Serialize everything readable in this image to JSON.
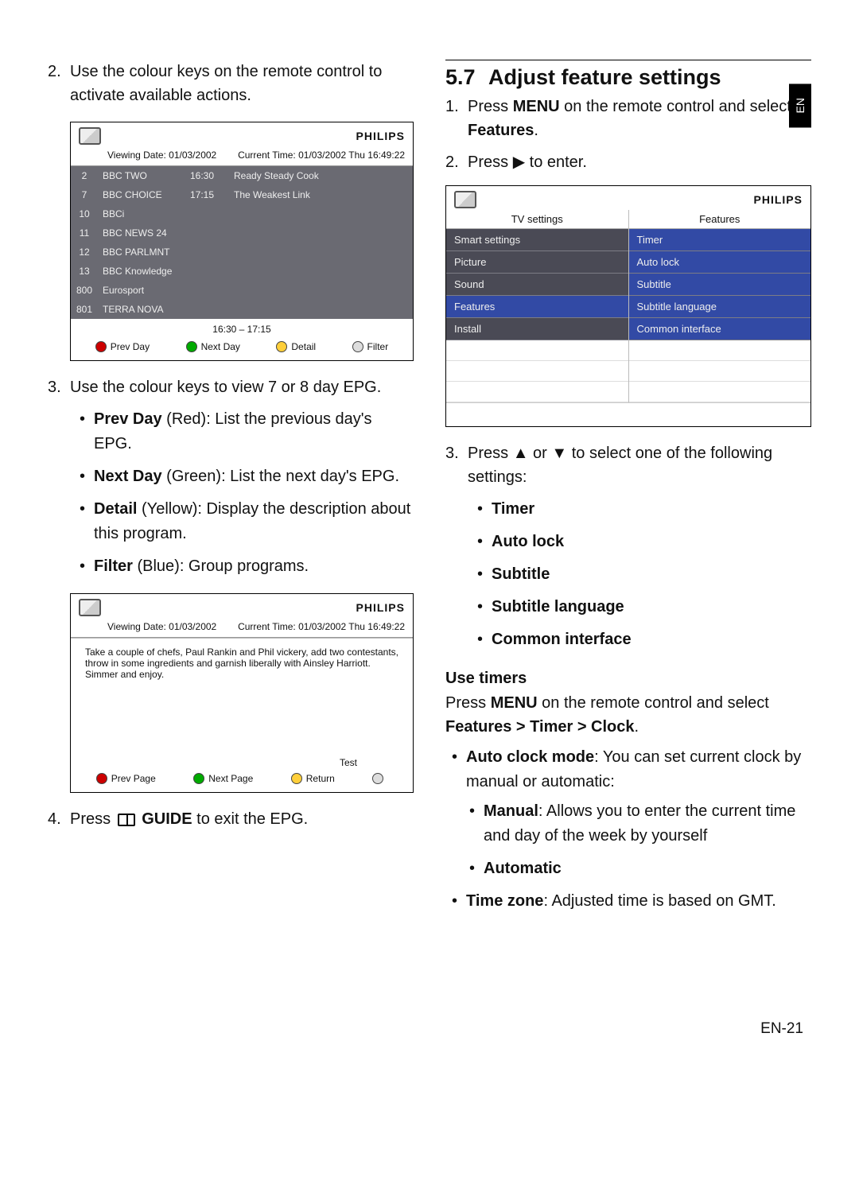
{
  "side_tab": "EN",
  "footer": "EN-21",
  "left": {
    "step2_num": "2.",
    "step2": "Use the colour keys on the remote control to activate available actions.",
    "step3_num": "3.",
    "step3": "Use the colour keys to view 7 or 8 day EPG.",
    "b_prev_label": "Prev Day",
    "b_prev_desc": " (Red): List the previous day's EPG.",
    "b_next_label": "Next Day",
    "b_next_desc": " (Green): List the next day's EPG.",
    "b_detail_label": "Detail",
    "b_detail_desc": " (Yellow): Display the description about this program.",
    "b_filter_label": "Filter",
    "b_filter_desc": " (Blue): Group programs.",
    "step4_num": "4.",
    "step4_a": "Press ",
    "step4_b": " GUIDE",
    "step4_c": " to exit the EPG."
  },
  "epg1": {
    "brand": "PHILIPS",
    "viewing_l": "Viewing Date: 01/03/2002",
    "viewing_r": "Current Time: 01/03/2002 Thu 16:49:22",
    "rows": [
      {
        "n": "2",
        "name": "BBC TWO",
        "t": "16:30",
        "p": "Ready Steady Cook",
        "sel": false
      },
      {
        "n": "7",
        "name": "BBC CHOICE",
        "t": "17:15",
        "p": "The Weakest Link",
        "sel": true
      },
      {
        "n": "10",
        "name": "BBCi",
        "t": "",
        "p": "",
        "sel": false
      },
      {
        "n": "11",
        "name": "BBC NEWS 24",
        "t": "",
        "p": "",
        "sel": false
      },
      {
        "n": "12",
        "name": "BBC PARLMNT",
        "t": "",
        "p": "",
        "sel": false
      },
      {
        "n": "13",
        "name": "BBC Knowledge",
        "t": "",
        "p": "",
        "sel": false
      },
      {
        "n": "800",
        "name": "Eurosport",
        "t": "",
        "p": "",
        "sel": false
      },
      {
        "n": "801",
        "name": "TERRA NOVA",
        "t": "",
        "p": "",
        "sel": false
      }
    ],
    "timefoot": "16:30 – 17:15",
    "btns": {
      "red": "Prev Day",
      "green": "Next Day",
      "yellow": "Detail",
      "blue": "Filter"
    }
  },
  "epg2": {
    "brand": "PHILIPS",
    "viewing_l": "Viewing Date: 01/03/2002",
    "viewing_r": "Current Time: 01/03/2002 Thu 16:49:22",
    "detail": "Take a couple of chefs, Paul Rankin and Phil vickery, add two contestants, throw in some ingredients and garnish liberally with Ainsley Harriott. Simmer and enjoy.",
    "test": "Test",
    "btns": {
      "red": "Prev Page",
      "green": "Next Page",
      "yellow": "Return",
      "blue": ""
    }
  },
  "right": {
    "h_num": "5.7",
    "h_title": "Adjust feature settings",
    "s1_num": "1.",
    "s1_a": "Press ",
    "s1_menu": "MENU",
    "s1_b": " on the remote control and select ",
    "s1_feat": "Features",
    "s1_c": ".",
    "s2_num": "2.",
    "s2_a": "Press ",
    "s2_b": " to enter.",
    "s3_num": "3.",
    "s3_a": "Press ",
    "s3_b": " or ",
    "s3_c": " to select one of the following settings:",
    "setlist": {
      "a": "Timer",
      "b": "Auto lock",
      "c": "Subtitle",
      "d": "Subtitle language",
      "e": "Common interface"
    },
    "use_timers": "Use timers",
    "ut_a": "Press ",
    "ut_menu": "MENU",
    "ut_b": " on the remote control and select ",
    "ut_path": "Features > Timer > Clock",
    "ut_c": ".",
    "acm_label": "Auto clock mode",
    "acm_text": ": You can set current clock by manual or automatic:",
    "manual_label": "Manual",
    "manual_text": ": Allows you to enter the current time and day of the week by yourself",
    "auto_label": "Automatic",
    "tz_label": "Time zone",
    "tz_text": ": Adjusted time is based on GMT."
  },
  "menu": {
    "brand": "PHILIPS",
    "left_h": "TV settings",
    "right_h": "Features",
    "left_items": {
      "a": "Smart settings",
      "b": "Picture",
      "c": "Sound",
      "d": "Features",
      "e": "Install"
    },
    "right_items": {
      "a": "Timer",
      "b": "Auto lock",
      "c": "Subtitle",
      "d": "Subtitle language",
      "e": "Common interface"
    }
  }
}
